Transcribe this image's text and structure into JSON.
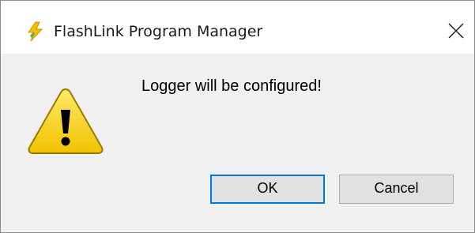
{
  "window": {
    "title": "FlashLink Program Manager",
    "app_icon": "flashlink-lightning-icon",
    "close_icon": "close-icon"
  },
  "dialog": {
    "icon": "warning-icon",
    "message": "Logger will be configured!",
    "buttons": {
      "ok_label": "OK",
      "cancel_label": "Cancel"
    }
  },
  "colors": {
    "body_background": "#f0f0f0",
    "focus_border": "#0078d7",
    "warning_fill": "#f5d000"
  }
}
